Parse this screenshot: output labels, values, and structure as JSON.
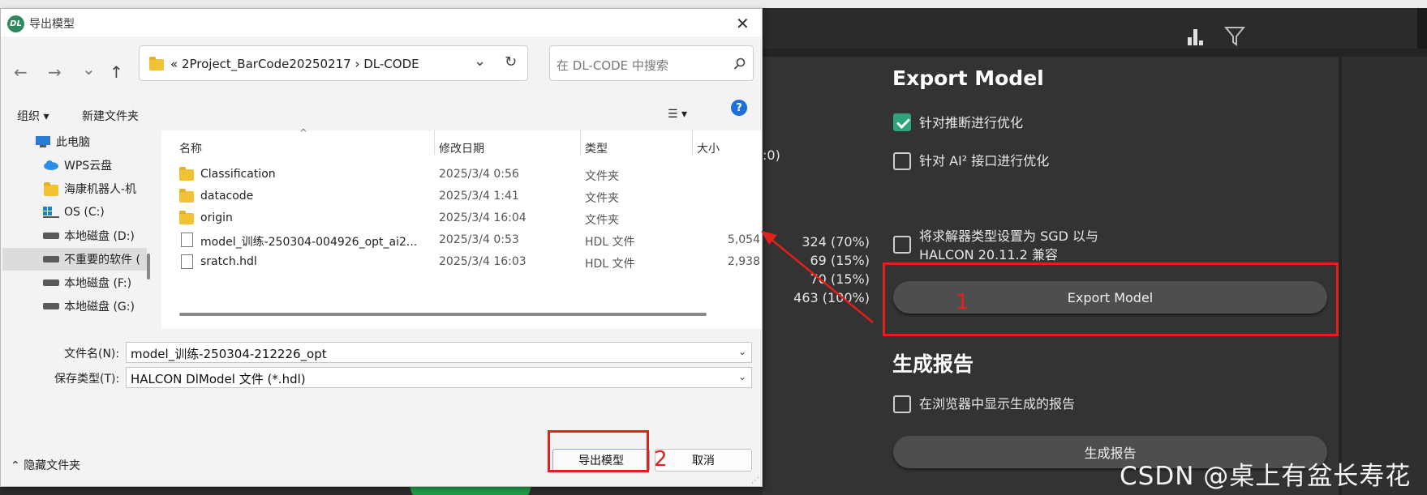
{
  "dialog": {
    "title": "导出模型",
    "logo_text": "DL",
    "close_glyph": "✕",
    "nav": {
      "back": "←",
      "forward": "→",
      "recent": "⌄",
      "up": "↑",
      "refresh": "↻",
      "address_dropdown": "⌄"
    },
    "address_text": "«  2Project_BarCode20250217  ›  DL-CODE",
    "search_placeholder": "在 DL-CODE 中搜索",
    "toolbar": {
      "organize": "组织 ▾",
      "new_folder": "新建文件夹",
      "view": "☰ ▾",
      "help": "?"
    },
    "nav_pane": [
      {
        "label": "此电脑",
        "icon": "computer-icon"
      },
      {
        "label": "WPS云盘",
        "icon": "cloud-icon"
      },
      {
        "label": "海康机器人-机",
        "icon": "folder-icon"
      },
      {
        "label": "OS (C:)",
        "icon": "drive-icon"
      },
      {
        "label": "本地磁盘 (D:)",
        "icon": "drive-icon"
      },
      {
        "label": "不重要的软件 (",
        "icon": "drive-icon"
      },
      {
        "label": "本地磁盘 (F:)",
        "icon": "drive-icon"
      },
      {
        "label": "本地磁盘 (G:)",
        "icon": "drive-icon"
      }
    ],
    "columns": {
      "name": "名称",
      "date": "修改日期",
      "type": "类型",
      "size": "大小"
    },
    "files": [
      {
        "name": "Classification",
        "date": "2025/3/4 0:56",
        "type": "文件夹",
        "size": "",
        "icon": "folder-icon"
      },
      {
        "name": "datacode",
        "date": "2025/3/4 1:41",
        "type": "文件夹",
        "size": "",
        "icon": "folder-icon"
      },
      {
        "name": "origin",
        "date": "2025/3/4 16:04",
        "type": "文件夹",
        "size": "",
        "icon": "folder-icon"
      },
      {
        "name": "model_训练-250304-004926_opt_ai2...",
        "date": "2025/3/4 0:53",
        "type": "HDL 文件",
        "size": "5,054",
        "icon": "file-icon"
      },
      {
        "name": "sratch.hdl",
        "date": "2025/3/4 16:03",
        "type": "HDL 文件",
        "size": "2,938",
        "icon": "file-icon"
      }
    ],
    "filename_label": "文件名(N):",
    "filename_value": "model_训练-250304-212226_opt",
    "filetype_label": "保存类型(T):",
    "filetype_value": "HALCON DlModel 文件 (*.hdl)",
    "hide_folders": "隐藏文件夹",
    "export_button": "导出模型",
    "cancel_button": "取消"
  },
  "background": {
    "partial_text": ":0)",
    "stats": [
      "324  (70%)",
      "69  (15%)",
      "70  (15%)",
      "463  (100%)"
    ],
    "export_panel": {
      "title": "Export Model",
      "options": [
        {
          "label": "针对推断进行优化",
          "checked": true
        },
        {
          "label": "针对 AI² 接口进行优化",
          "checked": false
        },
        {
          "label": "将求解器类型设置为 SGD 以与",
          "label2": "HALCON 20.11.2 兼容",
          "checked": false
        }
      ],
      "export_button": "Export Model",
      "report_title": "生成报告",
      "report_option": "在浏览器中显示生成的报告",
      "report_button": "生成报告"
    }
  },
  "annotations": {
    "step1": "1",
    "step2": "2"
  },
  "watermark": "CSDN @桌上有盆长寿花",
  "colors": {
    "annotation_red": "#e3201b",
    "checkbox_green": "#2fa37a",
    "panel_dark": "#333333"
  }
}
